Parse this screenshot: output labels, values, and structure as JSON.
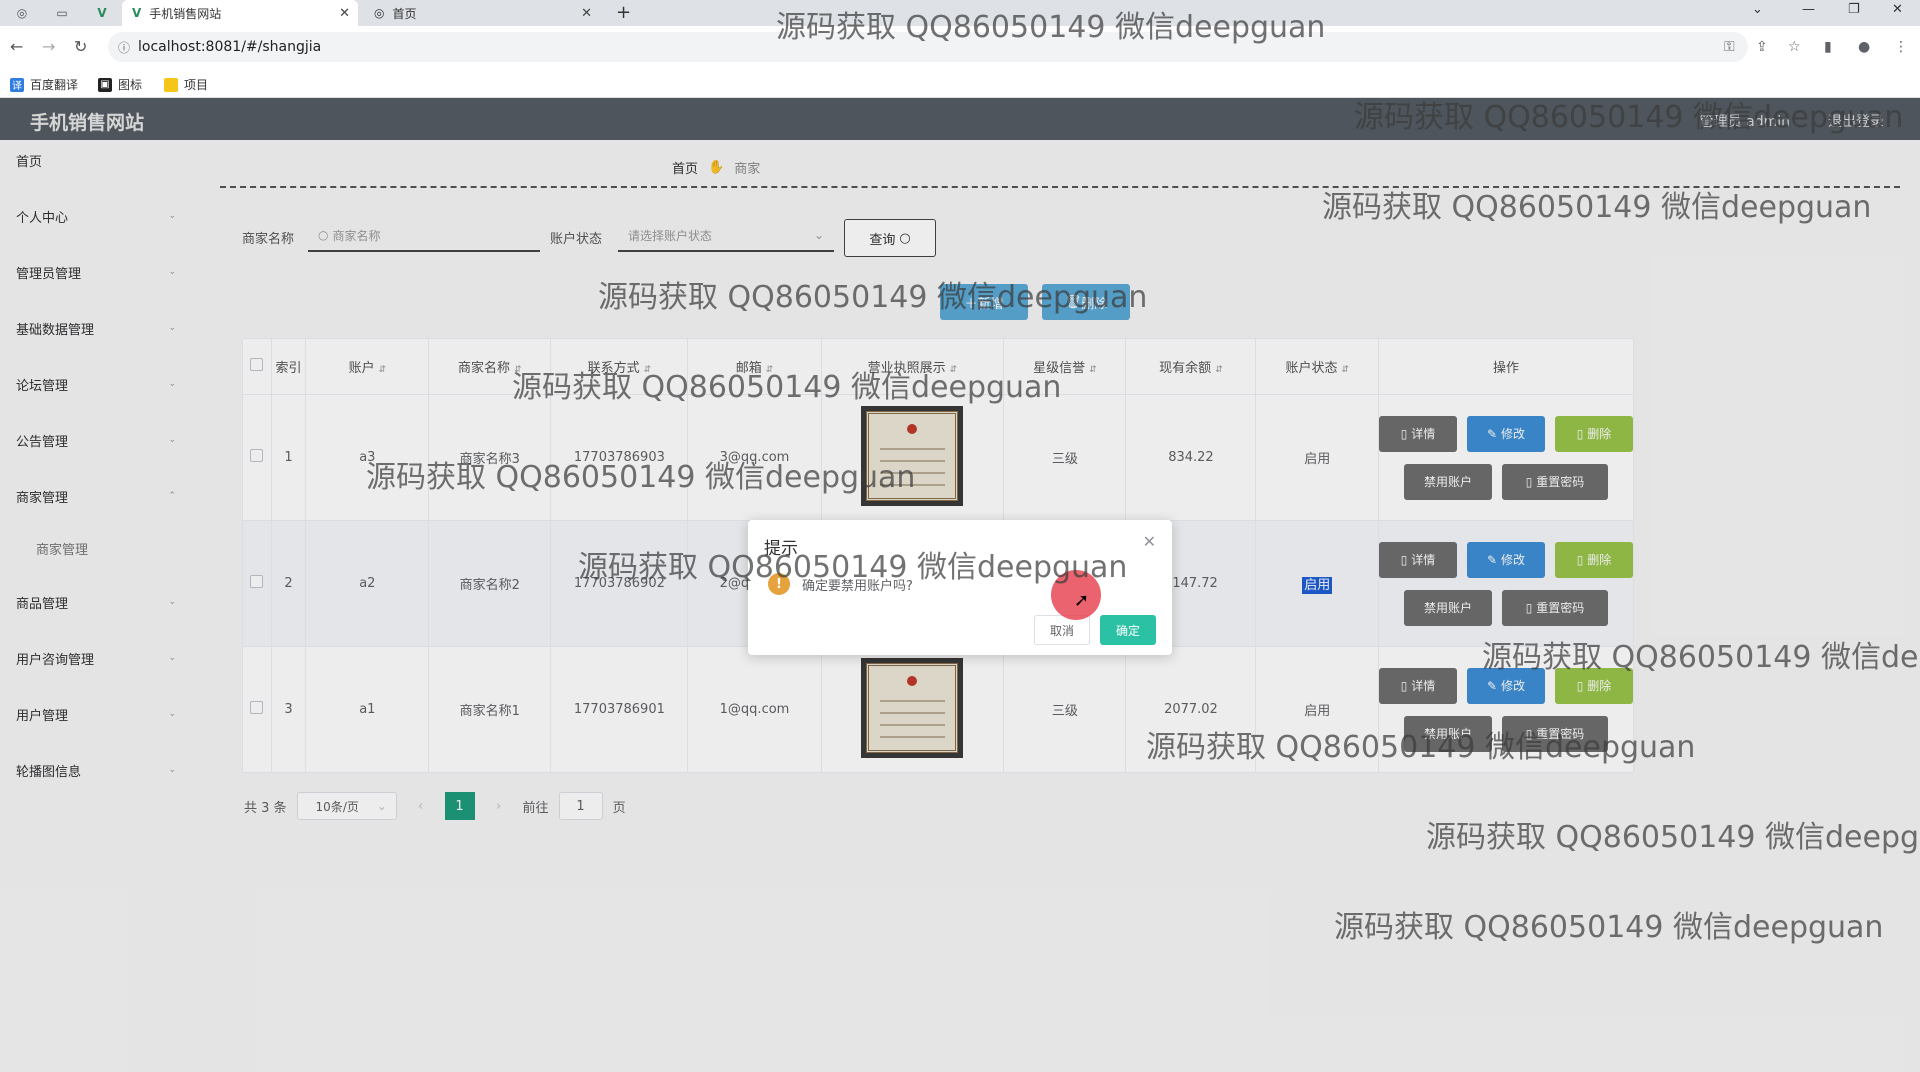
{
  "browser": {
    "tabs": [
      {
        "title": "手机销售网站",
        "fav": "V"
      },
      {
        "title": "首页",
        "fav": "◎"
      }
    ],
    "url": "localhost:8081/#/shangjia",
    "bookmarks": [
      "百度翻译",
      "图标",
      "项目"
    ]
  },
  "app": {
    "title": "手机销售网站",
    "user": "管理员 admin",
    "logout": "退出登录"
  },
  "sidebar": {
    "items": [
      "首页",
      "个人中心",
      "管理员管理",
      "基础数据管理",
      "论坛管理",
      "公告管理",
      "商家管理",
      "商家管理",
      "商品管理",
      "用户咨询管理",
      "用户管理",
      "轮播图信息"
    ]
  },
  "breadcrumb": {
    "home": "首页",
    "current": "商家"
  },
  "search": {
    "name_label": "商家名称",
    "name_placeholder": "商家名称",
    "status_label": "账户状态",
    "status_placeholder": "请选择账户状态",
    "query": "查询"
  },
  "actions": {
    "add": "新增",
    "delete": "删除"
  },
  "table": {
    "headers": [
      "索引",
      "账户",
      "商家名称",
      "联系方式",
      "邮箱",
      "营业执照展示",
      "星级信誉",
      "现有余额",
      "账户状态",
      "操作"
    ],
    "rows": [
      {
        "index": "1",
        "account": "a3",
        "name": "商家名称3",
        "phone": "17703786903",
        "email": "3@qq.com",
        "level": "三级",
        "balance": "834.22",
        "status": "启用"
      },
      {
        "index": "2",
        "account": "a2",
        "name": "商家名称2",
        "phone": "17703786902",
        "email": "2@qq.com",
        "level": "三级",
        "balance": "2147.72",
        "status": "启用"
      },
      {
        "index": "3",
        "account": "a1",
        "name": "商家名称1",
        "phone": "17703786901",
        "email": "1@qq.com",
        "level": "三级",
        "balance": "2077.02",
        "status": "启用"
      }
    ],
    "ops": {
      "detail": "详情",
      "edit": "修改",
      "delete": "删除",
      "ban": "禁用账户",
      "reset": "重置密码"
    }
  },
  "pager": {
    "total": "共 3 条",
    "size": "10条/页",
    "page": "1",
    "goto": "前往",
    "goto_value": "1",
    "page_unit": "页"
  },
  "dialog": {
    "title": "提示",
    "message": "确定要禁用账户吗?",
    "cancel": "取消",
    "confirm": "确定"
  },
  "watermark": "源码获取 QQ86050149 微信deepguan",
  "colors": {
    "header": "#545c64",
    "primary": "#1e9b7b",
    "confirm": "#2bc1a4",
    "edit": "#3d8fd6",
    "delete": "#98c44a",
    "warning": "#e6a23c"
  }
}
